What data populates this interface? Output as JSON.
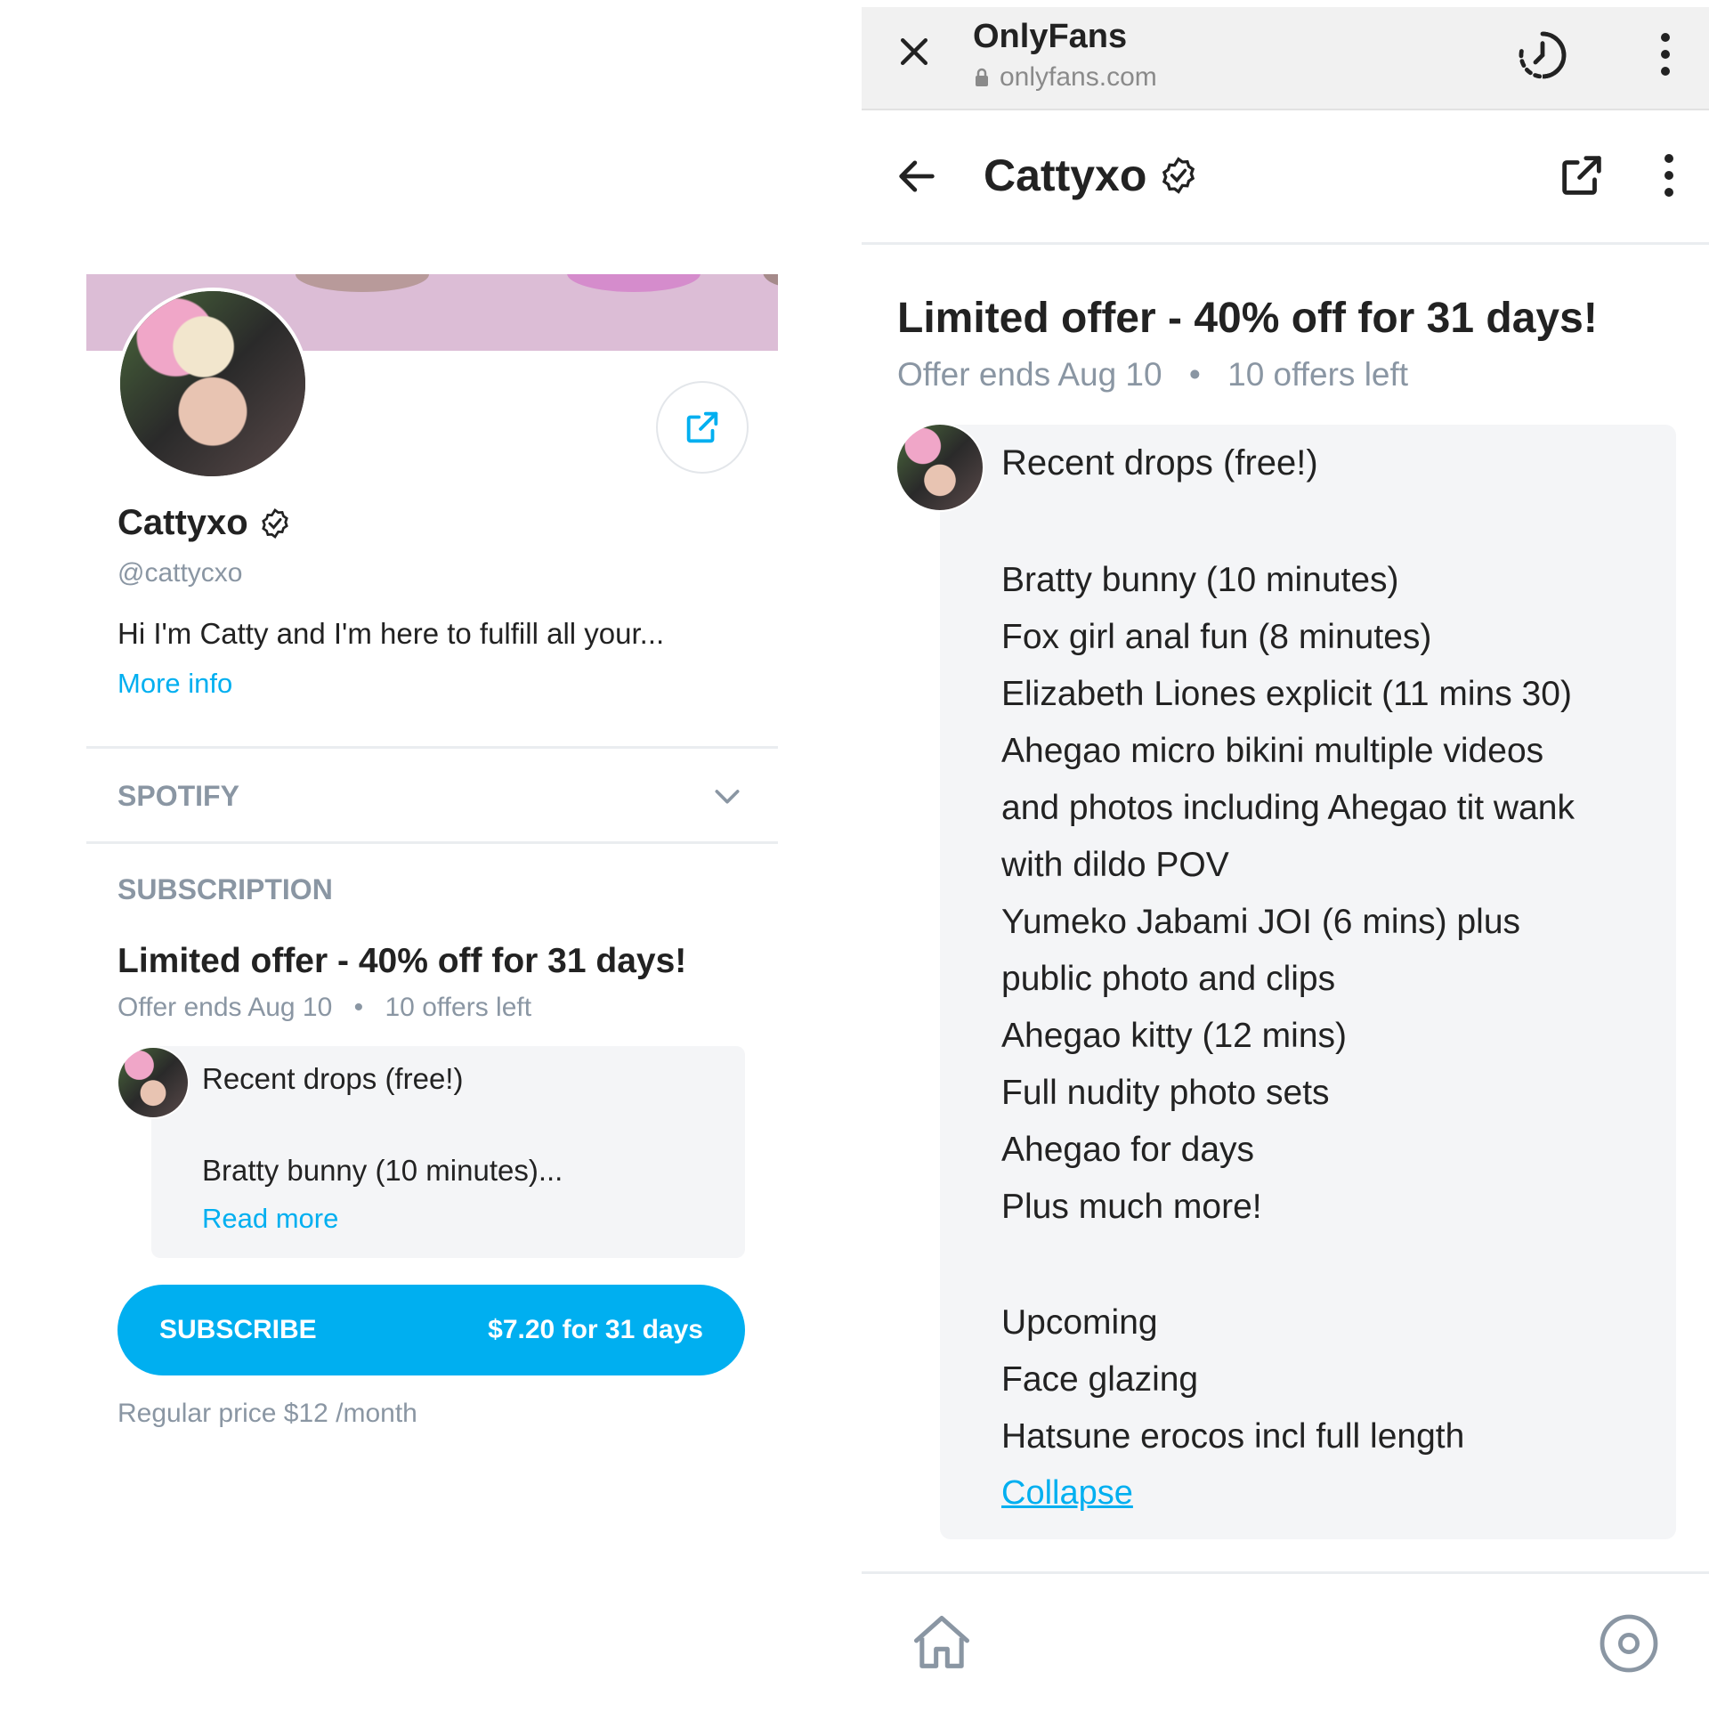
{
  "left": {
    "profile": {
      "name": "Cattyxo",
      "handle": "@cattycxo",
      "bio": "Hi I'm Catty and I'm here to fulfill all your...",
      "more_info": "More info"
    },
    "spotify": {
      "label": "SPOTIFY"
    },
    "subscription": {
      "section_label": "SUBSCRIPTION",
      "offer_title": "Limited offer - 40% off for 31 days!",
      "offer_ends": "Offer ends Aug 10",
      "offers_left": "10 offers left",
      "message_title": "Recent drops (free!)",
      "message_preview": "Bratty bunny (10 minutes)...",
      "read_more": "Read more",
      "subscribe_label": "SUBSCRIBE",
      "subscribe_price": "$7.20 for 31 days",
      "regular_price": "Regular price $12 /month"
    }
  },
  "right": {
    "browser": {
      "site_title": "OnlyFans",
      "url": "onlyfans.com"
    },
    "header": {
      "name": "Cattyxo"
    },
    "offer": {
      "title": "Limited offer - 40% off for 31 days!",
      "ends": "Offer ends Aug 10",
      "left": "10 offers left"
    },
    "message": {
      "title": "Recent drops (free!)",
      "items": [
        "Bratty bunny (10 minutes)",
        "Fox girl anal fun (8 minutes)",
        "Elizabeth Liones explicit (11 mins 30)",
        "Ahegao micro bikini multiple videos",
        "and photos including Ahegao tit wank",
        "with dildo POV",
        "Yumeko Jabami JOI (6 mins) plus",
        "public photo and clips",
        "Ahegao kitty (12 mins)",
        "Full nudity photo sets",
        "Ahegao for days",
        "Plus much more!"
      ],
      "upcoming": [
        "Upcoming",
        "Face glazing",
        "Hatsune erocos incl full length"
      ],
      "collapse": "Collapse"
    }
  },
  "colors": {
    "accent": "#00aff0",
    "gray_text": "#8a96a3",
    "banner": "#dcbdd6",
    "card_bg": "#f4f5f7"
  }
}
